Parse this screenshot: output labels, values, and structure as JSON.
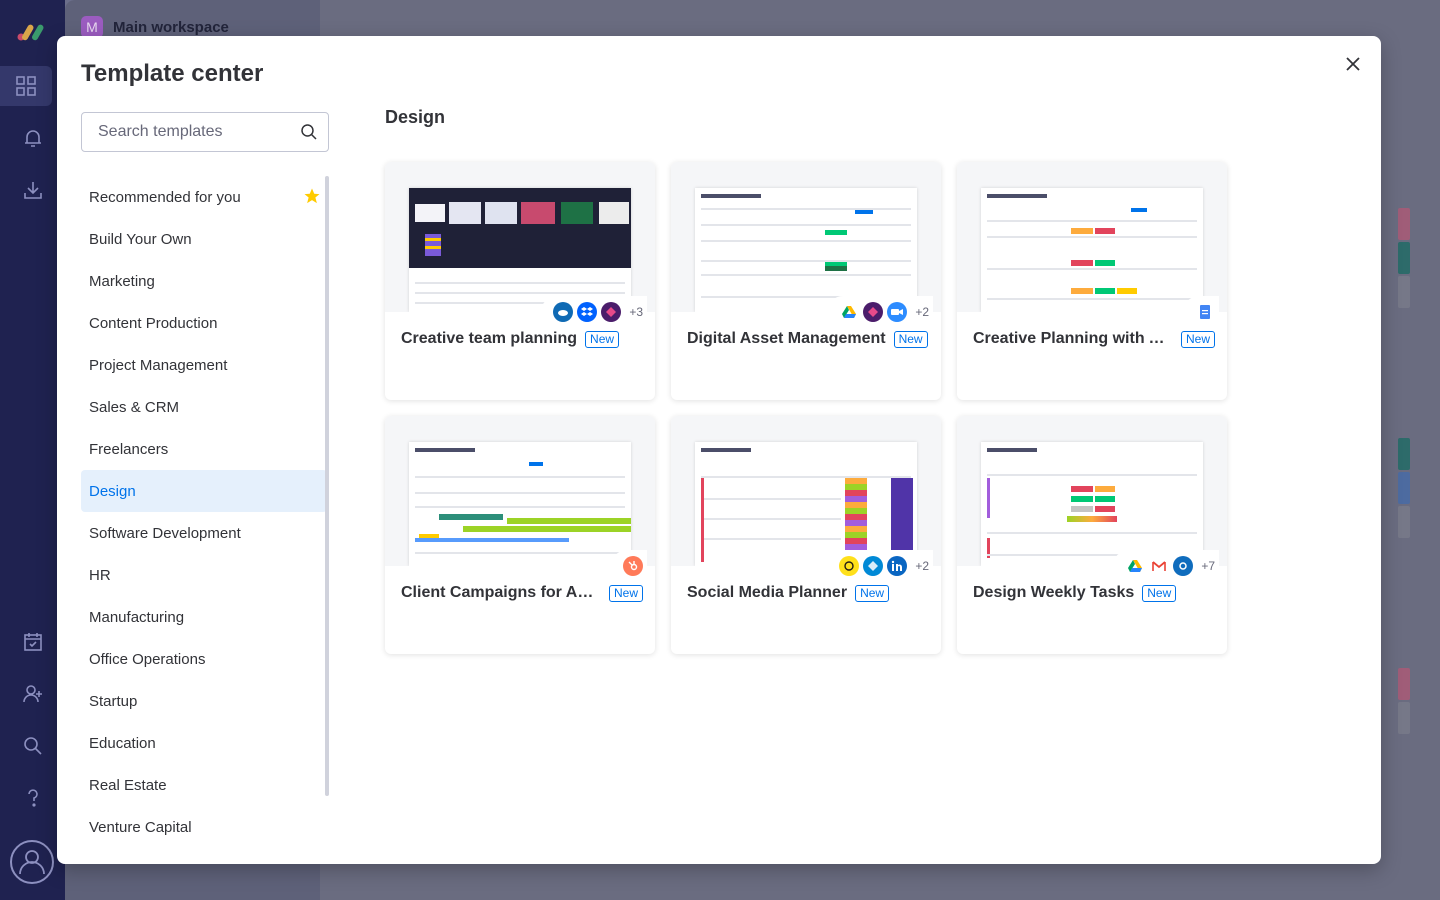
{
  "background": {
    "workspace_badge": "M",
    "workspace_title": "Main workspace"
  },
  "modal": {
    "title": "Template center",
    "search_placeholder": "Search templates",
    "section_title": "Design"
  },
  "categories": [
    {
      "label": "Recommended for you",
      "icon": "star-icon"
    },
    {
      "label": "Build Your Own"
    },
    {
      "label": "Marketing"
    },
    {
      "label": "Content Production"
    },
    {
      "label": "Project Management"
    },
    {
      "label": "Sales & CRM"
    },
    {
      "label": "Freelancers"
    },
    {
      "label": "Design",
      "selected": true
    },
    {
      "label": "Software Development"
    },
    {
      "label": "HR"
    },
    {
      "label": "Manufacturing"
    },
    {
      "label": "Office Operations"
    },
    {
      "label": "Startup"
    },
    {
      "label": "Education"
    },
    {
      "label": "Real Estate"
    },
    {
      "label": "Venture Capital"
    }
  ],
  "templates": [
    {
      "name": "Creative team planning",
      "badge": "New",
      "integrations": [
        "onedrive-icon",
        "dropbox-icon",
        "adobe-icon"
      ],
      "more": "+3"
    },
    {
      "name": "Digital Asset Management",
      "badge": "New",
      "integrations": [
        "google-drive-icon",
        "adobe-icon",
        "zoom-icon"
      ],
      "more": "+2"
    },
    {
      "name": "Creative Planning with Ad...",
      "badge": "New",
      "integrations": [
        "google-docs-icon"
      ],
      "more": ""
    },
    {
      "name": "Client Campaigns for Age...",
      "badge": "New",
      "integrations": [
        "hubspot-icon"
      ],
      "more": ""
    },
    {
      "name": "Social Media Planner",
      "badge": "New",
      "integrations": [
        "mailchimp-icon",
        "azure-icon",
        "linkedin-icon"
      ],
      "more": "+2"
    },
    {
      "name": "Design Weekly Tasks",
      "badge": "New",
      "integrations": [
        "google-drive-icon",
        "gmail-icon",
        "outlook-icon"
      ],
      "more": "+7"
    }
  ],
  "colors": {
    "accent": "#0073ea",
    "selected_bg": "#e5f0fc",
    "rail": "#1f2250"
  }
}
